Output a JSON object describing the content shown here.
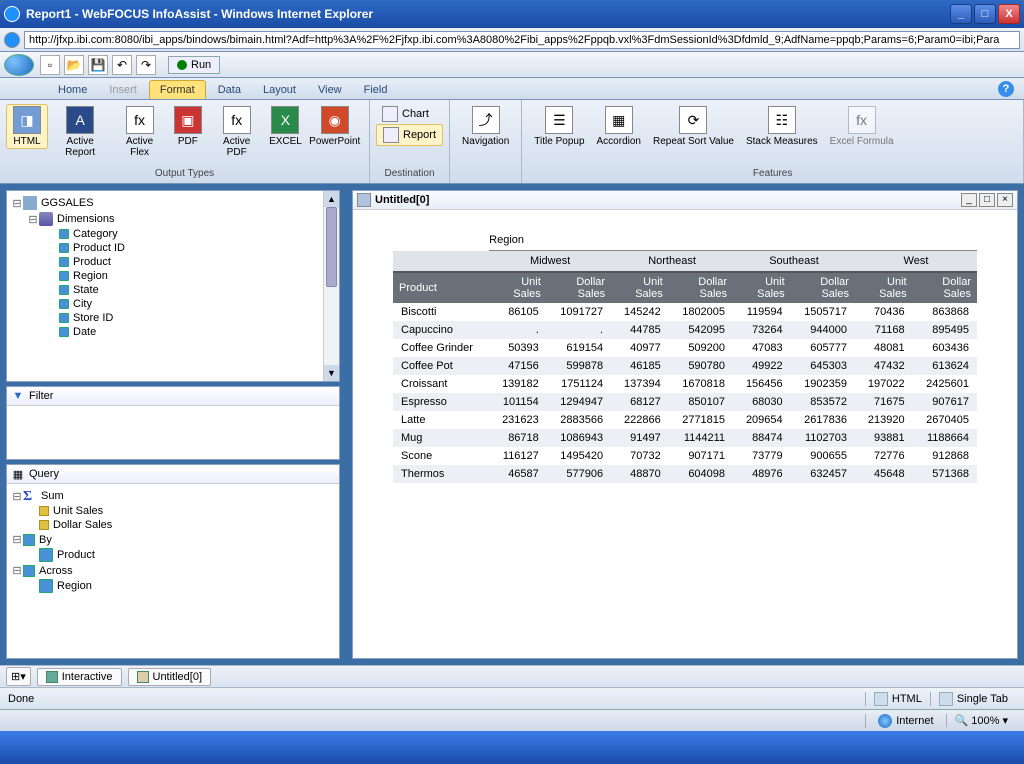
{
  "window": {
    "title": "Report1 - WebFOCUS InfoAssist - Windows Internet Explorer",
    "url": "http://jfxp.ibi.com:8080/ibi_apps/bindows/bimain.html?Adf=http%3A%2F%2Fjfxp.ibi.com%3A8080%2Fibi_apps%2Fppqb.vxl%3FdmSessionId%3Dfdmld_9;AdfName=ppqb;Params=6;Param0=ibi;Para"
  },
  "toolbar": {
    "run": "Run"
  },
  "menu": {
    "home": "Home",
    "insert": "Insert",
    "format": "Format",
    "data": "Data",
    "layout": "Layout",
    "view": "View",
    "field": "Field"
  },
  "ribbon": {
    "output_types": {
      "label": "Output Types",
      "html": "HTML",
      "active_report": "Active Report",
      "active_flex": "Active Flex",
      "pdf": "PDF",
      "active_pdf": "Active PDF",
      "excel": "EXCEL",
      "powerpoint": "PowerPoint"
    },
    "destination": {
      "label": "Destination",
      "chart": "Chart",
      "report": "Report"
    },
    "navigation": {
      "label": "Navigation"
    },
    "features": {
      "label": "Features",
      "title_popup": "Title Popup",
      "accordion": "Accordion",
      "repeat_sort": "Repeat Sort Value",
      "stack": "Stack Measures",
      "excel_formula": "Excel Formula"
    }
  },
  "tree": {
    "root": "GGSALES",
    "dimensions": "Dimensions",
    "fields": [
      "Category",
      "Product ID",
      "Product",
      "Region",
      "State",
      "City",
      "Store ID",
      "Date"
    ]
  },
  "panels": {
    "filter": "Filter",
    "query": "Query"
  },
  "query": {
    "sum": "Sum",
    "by": "By",
    "across": "Across",
    "measures": [
      "Unit Sales",
      "Dollar Sales"
    ],
    "by_fields": [
      "Product"
    ],
    "across_fields": [
      "Region"
    ]
  },
  "bottom_tabs": {
    "interactive": "Interactive",
    "untitled": "Untitled[0]"
  },
  "status": {
    "html": "HTML",
    "single_tab": "Single Tab",
    "done": "Done",
    "internet": "Internet",
    "zoom": "100%"
  },
  "report": {
    "title": "Untitled[0]",
    "region_label": "Region",
    "product_label": "Product",
    "regions": [
      "Midwest",
      "Northeast",
      "Southeast",
      "West"
    ],
    "measure_cols": [
      "Unit Sales",
      "Dollar Sales"
    ],
    "rows": [
      {
        "p": "Biscotti",
        "v": [
          "86105",
          "1091727",
          "145242",
          "1802005",
          "119594",
          "1505717",
          "70436",
          "863868"
        ]
      },
      {
        "p": "Capuccino",
        "v": [
          ".",
          ".",
          "44785",
          "542095",
          "73264",
          "944000",
          "71168",
          "895495"
        ]
      },
      {
        "p": "Coffee Grinder",
        "v": [
          "50393",
          "619154",
          "40977",
          "509200",
          "47083",
          "605777",
          "48081",
          "603436"
        ]
      },
      {
        "p": "Coffee Pot",
        "v": [
          "47156",
          "599878",
          "46185",
          "590780",
          "49922",
          "645303",
          "47432",
          "613624"
        ]
      },
      {
        "p": "Croissant",
        "v": [
          "139182",
          "1751124",
          "137394",
          "1670818",
          "156456",
          "1902359",
          "197022",
          "2425601"
        ]
      },
      {
        "p": "Espresso",
        "v": [
          "101154",
          "1294947",
          "68127",
          "850107",
          "68030",
          "853572",
          "71675",
          "907617"
        ]
      },
      {
        "p": "Latte",
        "v": [
          "231623",
          "2883566",
          "222866",
          "2771815",
          "209654",
          "2617836",
          "213920",
          "2670405"
        ]
      },
      {
        "p": "Mug",
        "v": [
          "86718",
          "1086943",
          "91497",
          "1144211",
          "88474",
          "1102703",
          "93881",
          "1188664"
        ]
      },
      {
        "p": "Scone",
        "v": [
          "116127",
          "1495420",
          "70732",
          "907171",
          "73779",
          "900655",
          "72776",
          "912868"
        ]
      },
      {
        "p": "Thermos",
        "v": [
          "46587",
          "577906",
          "48870",
          "604098",
          "48976",
          "632457",
          "45648",
          "571368"
        ]
      }
    ]
  }
}
